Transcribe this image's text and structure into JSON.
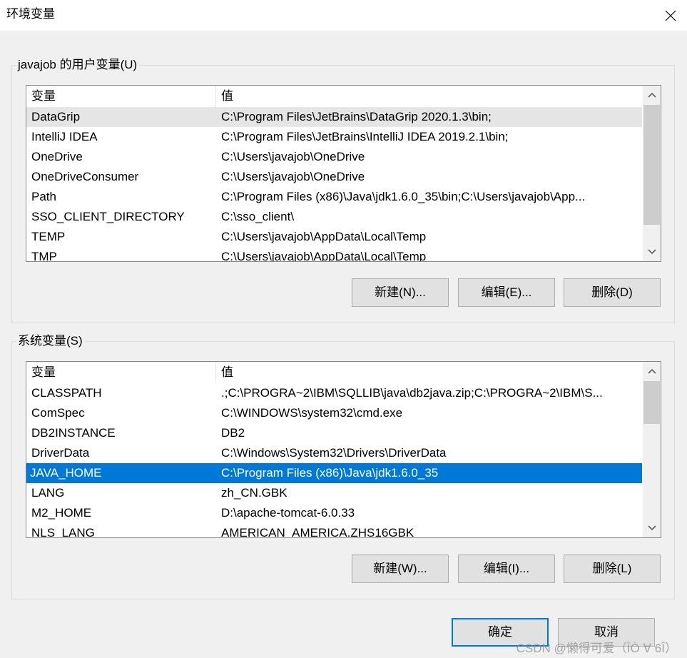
{
  "window": {
    "title": "环境变量"
  },
  "user_vars": {
    "group_label": "javajob 的用户变量(U)",
    "col_name": "变量",
    "col_value": "值",
    "rows": [
      {
        "name": "DataGrip",
        "value": "C:\\Program Files\\JetBrains\\DataGrip 2020.1.3\\bin;"
      },
      {
        "name": "IntelliJ IDEA",
        "value": "C:\\Program Files\\JetBrains\\IntelliJ IDEA 2019.2.1\\bin;"
      },
      {
        "name": "OneDrive",
        "value": "C:\\Users\\javajob\\OneDrive"
      },
      {
        "name": "OneDriveConsumer",
        "value": "C:\\Users\\javajob\\OneDrive"
      },
      {
        "name": "Path",
        "value": "C:\\Program Files (x86)\\Java\\jdk1.6.0_35\\bin;C:\\Users\\javajob\\App..."
      },
      {
        "name": "SSO_CLIENT_DIRECTORY",
        "value": "C:\\sso_client\\"
      },
      {
        "name": "TEMP",
        "value": "C:\\Users\\javajob\\AppData\\Local\\Temp"
      },
      {
        "name": "TMP",
        "value": "C:\\Users\\javajob\\AppData\\Local\\Temp"
      }
    ],
    "buttons": {
      "new": "新建(N)...",
      "edit": "编辑(E)...",
      "delete": "删除(D)"
    }
  },
  "system_vars": {
    "group_label": "系统变量(S)",
    "col_name": "变量",
    "col_value": "值",
    "rows": [
      {
        "name": "CLASSPATH",
        "value": ".;C:\\PROGRA~2\\IBM\\SQLLIB\\java\\db2java.zip;C:\\PROGRA~2\\IBM\\S..."
      },
      {
        "name": "ComSpec",
        "value": "C:\\WINDOWS\\system32\\cmd.exe"
      },
      {
        "name": "DB2INSTANCE",
        "value": "DB2"
      },
      {
        "name": "DriverData",
        "value": "C:\\Windows\\System32\\Drivers\\DriverData"
      },
      {
        "name": "JAVA_HOME",
        "value": "C:\\Program Files (x86)\\Java\\jdk1.6.0_35"
      },
      {
        "name": "LANG",
        "value": "zh_CN.GBK"
      },
      {
        "name": "M2_HOME",
        "value": "D:\\apache-tomcat-6.0.33"
      },
      {
        "name": "NLS_LANG",
        "value": "AMERICAN_AMERICA.ZHS16GBK"
      }
    ],
    "buttons": {
      "new": "新建(W)...",
      "edit": "编辑(I)...",
      "delete": "删除(L)"
    }
  },
  "footer": {
    "ok": "确定",
    "cancel": "取消"
  },
  "watermark": "CSDN @懒得可爱（ÎÒ ∀ 6Î）",
  "colors": {
    "selection": "#0078d7",
    "hover": "#e5e5e5",
    "background": "#f0f0f0"
  }
}
